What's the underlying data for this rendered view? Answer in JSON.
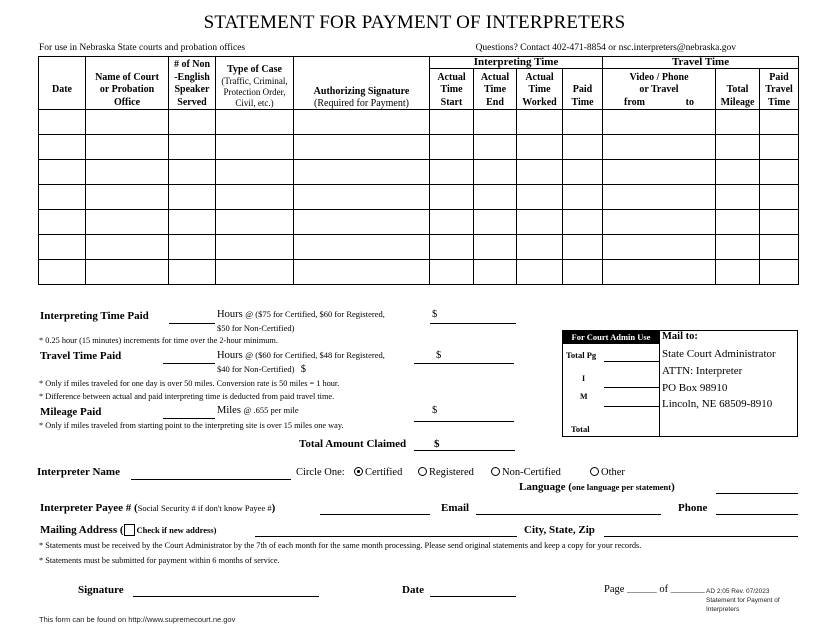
{
  "title": "STATEMENT FOR PAYMENT OF INTERPRETERS",
  "subtitle_left": "For use in Nebraska State courts and probation offices",
  "subtitle_right": "Questions?  Contact 402-471-8854 or nsc.interpreters@nebraska.gov",
  "table": {
    "group_interpreting": "Interpreting Time",
    "group_travel": "Travel Time",
    "columns": {
      "date": "Date",
      "court_l1": "Name of Court",
      "court_l2": "or Probation",
      "court_l3": "Office",
      "speaker_l1": "# of Non",
      "speaker_l2": "-English",
      "speaker_l3": "Speaker",
      "speaker_l4": "Served",
      "case_l1": "Type of Case",
      "case_l2": "(Traffic, Criminal,",
      "case_l3": "Protection Order,",
      "case_l4": "Civil, etc.)",
      "auth_l1": "Authorizing Signature",
      "auth_l2": "(Required for Payment)",
      "start_l1": "Actual",
      "start_l2": "Time",
      "start_l3": "Start",
      "end_l1": "Actual",
      "end_l2": "Time",
      "end_l3": "End",
      "worked_l1": "Actual",
      "worked_l2": "Time",
      "worked_l3": "Worked",
      "paid_l1": "Paid",
      "paid_l2": "Time",
      "video_l1": "Video / Phone",
      "video_l2": "or  Travel",
      "video_from": "from",
      "video_to": "to",
      "mileage_l1": "Total",
      "mileage_l2": "Mileage",
      "ptravel_l1": "Paid",
      "ptravel_l2": "Travel",
      "ptravel_l3": "Time"
    },
    "rows": [
      [
        "",
        "",
        "",
        "",
        "",
        "",
        "",
        "",
        "",
        "",
        "",
        ""
      ],
      [
        "",
        "",
        "",
        "",
        "",
        "",
        "",
        "",
        "",
        "",
        "",
        ""
      ],
      [
        "",
        "",
        "",
        "",
        "",
        "",
        "",
        "",
        "",
        "",
        "",
        ""
      ],
      [
        "",
        "",
        "",
        "",
        "",
        "",
        "",
        "",
        "",
        "",
        "",
        ""
      ],
      [
        "",
        "",
        "",
        "",
        "",
        "",
        "",
        "",
        "",
        "",
        "",
        ""
      ],
      [
        "",
        "",
        "",
        "",
        "",
        "",
        "",
        "",
        "",
        "",
        "",
        ""
      ],
      [
        "",
        "",
        "",
        "",
        "",
        "",
        "",
        "",
        "",
        "",
        "",
        ""
      ]
    ]
  },
  "payment": {
    "interp_label": "Interpreting Time Paid",
    "interp_hours": "Hours",
    "interp_rate_l1": "@ ($75 for Certified, $60 for Registered,",
    "interp_rate_l2": "$50 for Non-Certified)",
    "interp_note": "* 0.25 hour (15 minutes) increments for time over the 2-hour minimum.",
    "travel_label": "Travel Time Paid",
    "travel_hours": "Hours",
    "travel_rate_l1": "@ ($60 for Certified, $48 for Registered,",
    "travel_rate_l2": "$40 for Non-Certified)",
    "travel_rate_dollar": "$",
    "travel_note1": "* Only if miles traveled for one day is over 50 miles. Conversion rate is 50 miles = 1  hour.",
    "travel_note2": "* Difference between actual and paid interpreting time is deducted from paid travel time.",
    "mileage_label": "Mileage Paid",
    "mileage_miles": "Miles",
    "mileage_rate": "@ .655 per mile",
    "mileage_note": "* Only if miles traveled from starting point to the interpreting site is over 15 miles one way.",
    "total_label": "Total Amount Claimed",
    "dollar": "$"
  },
  "admin_box": {
    "header": "For Court Admin Use",
    "total_pg": "Total Pg",
    "i": "I",
    "m": "M",
    "total": "Total",
    "mail_to": "Mail to:",
    "addr1": "State Court Administrator",
    "addr2": "ATTN: Interpreter",
    "addr3": "PO Box 98910",
    "addr4": "Lincoln, NE 68509-8910"
  },
  "interpreter": {
    "name_label": "Interpreter Name",
    "circle_one": "Circle One:",
    "options": [
      {
        "label": "Certified",
        "selected": true
      },
      {
        "label": "Registered",
        "selected": false
      },
      {
        "label": "Non-Certified",
        "selected": false
      },
      {
        "label": "Other",
        "selected": false
      }
    ],
    "language_label": "Language (",
    "language_hint": "one language per statement",
    "language_close": ")",
    "payee_label": "Interpreter Payee # (",
    "payee_hint": "Social Security # if don't know Payee #",
    "payee_close": ")",
    "email_label": "Email",
    "phone_label": "Phone",
    "address_label": "Mailing Address (",
    "address_check": "Check if new address)",
    "city_label": "City, State, Zip",
    "note1": "* Statements must be received by the Court Administrator by the 7th of each month for the same month processing. Please send original statements and keep a copy for your records.",
    "note2": "* Statements must be submitted for payment within 6 months of service."
  },
  "footer": {
    "signature_label": "Signature",
    "date_label": "Date",
    "page_label": "Page",
    "page_blank": "_______",
    "of_label": "of",
    "of_blank": "________",
    "form_id_l1": "AD 2:05 Rev. 07/2023",
    "form_id_l2": "Statement for Payment of",
    "form_id_l3": "Interpreters",
    "url_note": "This form can be found on http://www.supremecourt.ne.gov"
  }
}
